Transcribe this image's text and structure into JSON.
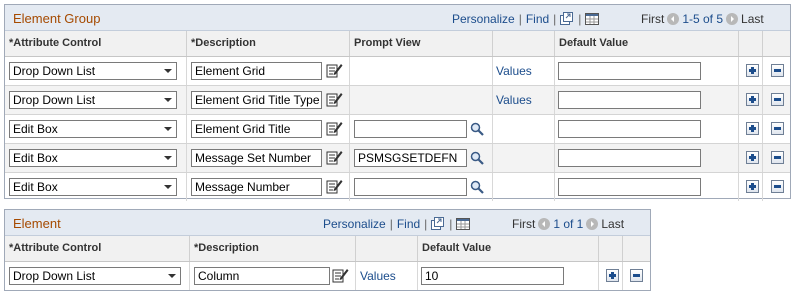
{
  "element_group": {
    "title": "Element Group",
    "nav": {
      "personalize": "Personalize",
      "find": "Find",
      "first": "First",
      "range": "1-5 of 5",
      "last": "Last"
    },
    "columns": {
      "attribute_control": "*Attribute Control",
      "description": "*Description",
      "prompt_view": "Prompt View",
      "default_value": "Default Value"
    },
    "rows": [
      {
        "control": "Drop Down List",
        "description": "Element Grid",
        "prompt": null,
        "values_link": "Values",
        "default": ""
      },
      {
        "control": "Drop Down List",
        "description": "Element Grid Title Type",
        "prompt": null,
        "values_link": "Values",
        "default": ""
      },
      {
        "control": "Edit Box",
        "description": "Element Grid Title",
        "prompt": "",
        "values_link": null,
        "default": ""
      },
      {
        "control": "Edit Box",
        "description": "Message Set Number",
        "prompt": "PSMSGSETDEFN",
        "values_link": null,
        "default": ""
      },
      {
        "control": "Edit Box",
        "description": "Message Number",
        "prompt": "",
        "values_link": null,
        "default": ""
      }
    ]
  },
  "element": {
    "title": "Element",
    "nav": {
      "personalize": "Personalize",
      "find": "Find",
      "first": "First",
      "range": "1 of 1",
      "last": "Last"
    },
    "columns": {
      "attribute_control": "*Attribute Control",
      "description": "*Description",
      "default_value": "Default Value"
    },
    "rows": [
      {
        "control": "Drop Down List",
        "description": "Column",
        "values_link": "Values",
        "default": "10"
      }
    ]
  },
  "icons": [
    "edit-description-icon",
    "lookup-icon",
    "view-all-icon",
    "download-grid-icon",
    "previous-icon",
    "next-icon",
    "add-row-icon",
    "delete-row-icon"
  ]
}
